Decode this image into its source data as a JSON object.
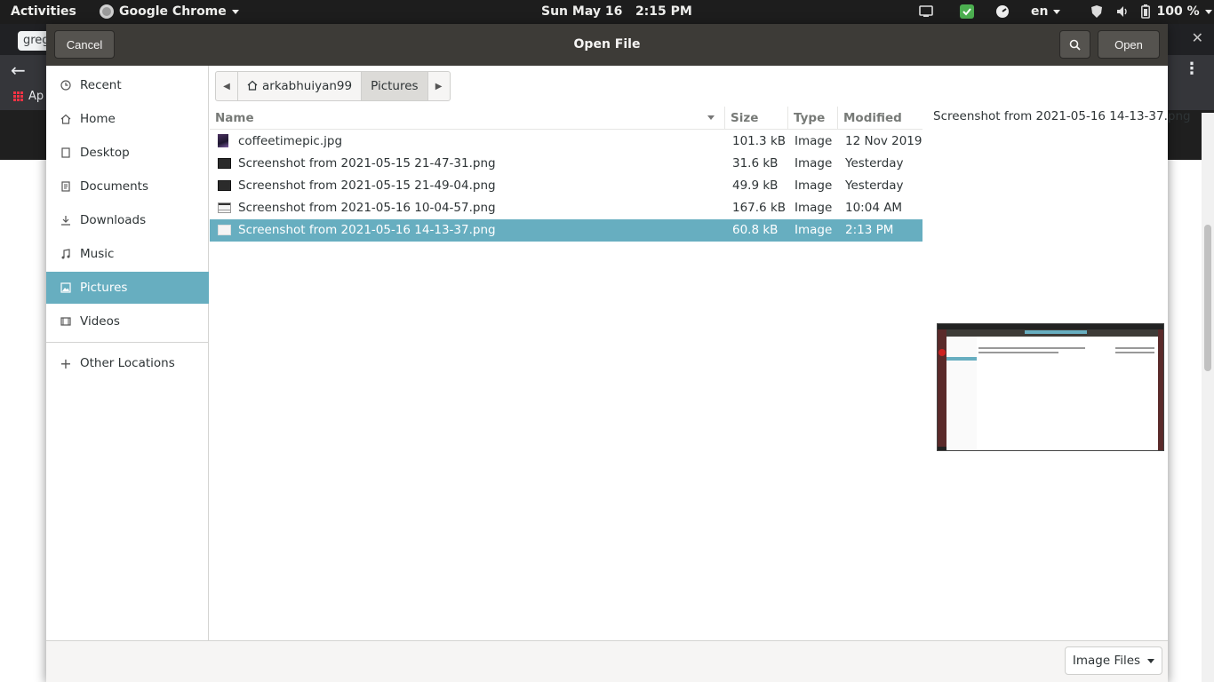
{
  "topbar": {
    "activities": "Activities",
    "app_name": "Google Chrome",
    "clock": "Sun May 16   2:15 PM",
    "lang": "en",
    "battery": "100 %"
  },
  "chrome": {
    "tab_text": "greg",
    "bookmark_text": "Ap"
  },
  "dialog": {
    "title": "Open File",
    "cancel_label": "Cancel",
    "open_label": "Open",
    "filter_label": "Image Files"
  },
  "sidebar": {
    "items": [
      {
        "label": "Recent",
        "icon": "clock-icon"
      },
      {
        "label": "Home",
        "icon": "home-icon"
      },
      {
        "label": "Desktop",
        "icon": "desktop-icon"
      },
      {
        "label": "Documents",
        "icon": "document-icon"
      },
      {
        "label": "Downloads",
        "icon": "download-icon"
      },
      {
        "label": "Music",
        "icon": "music-icon"
      },
      {
        "label": "Pictures",
        "icon": "picture-icon"
      },
      {
        "label": "Videos",
        "icon": "video-icon"
      }
    ],
    "other_locations": "Other Locations"
  },
  "pathbar": {
    "home": "arkabhuiyan99",
    "current": "Pictures"
  },
  "columns": {
    "name": "Name",
    "size": "Size",
    "type": "Type",
    "modified": "Modified"
  },
  "files": [
    {
      "name": "coffeetimepic.jpg",
      "size": "101.3 kB",
      "type": "Image",
      "modified": "12 Nov 2019",
      "selected": false
    },
    {
      "name": "Screenshot from 2021-05-15 21-47-31.png",
      "size": "31.6 kB",
      "type": "Image",
      "modified": "Yesterday",
      "selected": false
    },
    {
      "name": "Screenshot from 2021-05-15 21-49-04.png",
      "size": "49.9 kB",
      "type": "Image",
      "modified": "Yesterday",
      "selected": false
    },
    {
      "name": "Screenshot from 2021-05-16 10-04-57.png",
      "size": "167.6 kB",
      "type": "Image",
      "modified": "10:04 AM",
      "selected": false
    },
    {
      "name": "Screenshot from 2021-05-16 14-13-37.png",
      "size": "60.8 kB",
      "type": "Image",
      "modified": "2:13 PM",
      "selected": true
    }
  ],
  "preview": {
    "filename": "Screenshot from 2021-05-16 14-13-37.png"
  },
  "colors": {
    "selection": "#67aec0",
    "headerbar": "#3d3b37",
    "topbar": "#1d1d1d"
  }
}
